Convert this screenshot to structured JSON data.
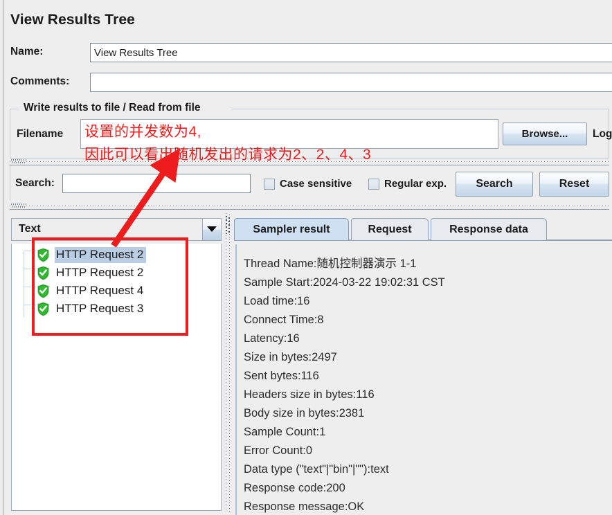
{
  "panel": {
    "title": "View Results Tree"
  },
  "fields": {
    "name_label": "Name:",
    "name_value": "View Results Tree",
    "comments_label": "Comments:",
    "comments_value": ""
  },
  "write_group": {
    "title": "Write results to file / Read from file",
    "filename_label": "Filename",
    "filename_value": "",
    "browse_label": "Browse...",
    "log_label": "Log"
  },
  "search_bar": {
    "search_label": "Search:",
    "search_value": "",
    "case_sensitive_label": "Case sensitive",
    "case_sensitive_checked": false,
    "regular_exp_label": "Regular exp.",
    "regular_exp_checked": false,
    "search_button": "Search",
    "reset_button": "Reset"
  },
  "left_pane": {
    "renderer_selected": "Text",
    "tree_items": [
      {
        "label": "HTTP Request 2",
        "status": "success",
        "selected": true
      },
      {
        "label": "HTTP Request 2",
        "status": "success",
        "selected": false
      },
      {
        "label": "HTTP Request 4",
        "status": "success",
        "selected": false
      },
      {
        "label": "HTTP Request 3",
        "status": "success",
        "selected": false
      }
    ]
  },
  "right_pane": {
    "tabs": [
      {
        "label": "Sampler result",
        "active": true
      },
      {
        "label": "Request",
        "active": false
      },
      {
        "label": "Response data",
        "active": false
      }
    ],
    "sampler_result": [
      "Thread Name:随机控制器演示 1-1",
      "Sample Start:2024-03-22 19:02:31 CST",
      "Load time:16",
      "Connect Time:8",
      "Latency:16",
      "Size in bytes:2497",
      "Sent bytes:116",
      "Headers size in bytes:116",
      "Body size in bytes:2381",
      "Sample Count:1",
      "Error Count:0",
      "Data type (\"text\"|\"bin\"|\"\"):text",
      "Response code:200",
      "Response message:OK"
    ]
  },
  "annotations": {
    "line1": "设置的并发数为4,",
    "line2": "因此可以看出随机发出的请求为2、2、4、3",
    "color": "#ee1c1c"
  },
  "colors": {
    "window_bg": "#eeeeee",
    "selection": "#b9cde4",
    "active_tab": "#cfe0f2",
    "annotation_red": "#ee1c1c",
    "shield_green": "#21a821"
  }
}
